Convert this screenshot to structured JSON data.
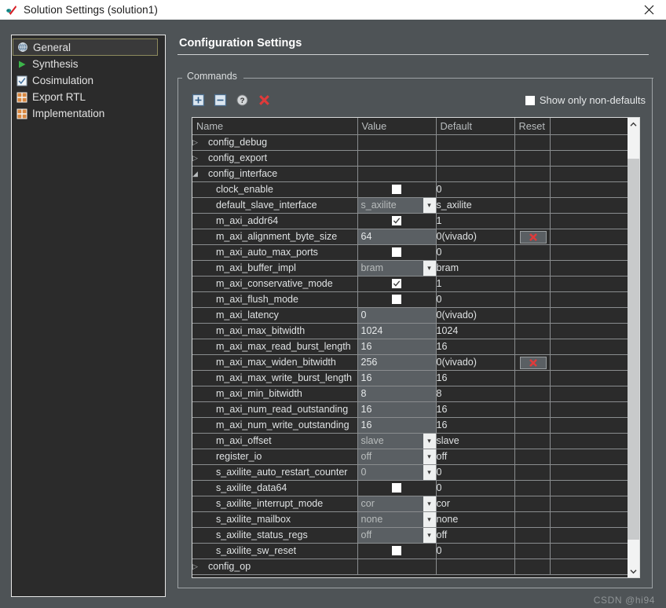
{
  "window": {
    "title": "Solution Settings (solution1)",
    "app_icon": "vivado-hls-icon",
    "close_label": "✕"
  },
  "sidebar": {
    "items": [
      {
        "label": "General",
        "icon": "gear-globe-icon",
        "selected": true
      },
      {
        "label": "Synthesis",
        "icon": "play-icon",
        "selected": false
      },
      {
        "label": "Cosimulation",
        "icon": "checkbox-icon",
        "selected": false
      },
      {
        "label": "Export RTL",
        "icon": "grid-icon",
        "selected": false
      },
      {
        "label": "Implementation",
        "icon": "grid-icon",
        "selected": false
      }
    ]
  },
  "main": {
    "title": "Configuration Settings",
    "group_label": "Commands",
    "toolbar": [
      {
        "name": "expand-all-icon",
        "tooltip": "Expand All"
      },
      {
        "name": "collapse-all-icon",
        "tooltip": "Collapse All"
      },
      {
        "name": "help-icon",
        "tooltip": "Help"
      },
      {
        "name": "delete-icon",
        "tooltip": "Delete"
      }
    ],
    "show_non_defaults": {
      "label": "Show only non-defaults",
      "checked": false
    }
  },
  "table": {
    "columns": [
      "Name",
      "Value",
      "Default",
      "Reset",
      ""
    ],
    "rows": [
      {
        "kind": "group",
        "expanded": false,
        "name": "config_debug",
        "value_type": "none",
        "value": "",
        "default": "",
        "reset": false
      },
      {
        "kind": "group",
        "expanded": false,
        "name": "config_export",
        "value_type": "none",
        "value": "",
        "default": "",
        "reset": false
      },
      {
        "kind": "group",
        "expanded": true,
        "name": "config_interface",
        "value_type": "none",
        "value": "",
        "default": "",
        "reset": false
      },
      {
        "kind": "child",
        "name": "clock_enable",
        "value_type": "checkbox",
        "value": false,
        "default": "0",
        "reset": false
      },
      {
        "kind": "child",
        "name": "default_slave_interface",
        "value_type": "combo",
        "value": "s_axilite",
        "default": "s_axilite",
        "reset": false
      },
      {
        "kind": "child",
        "name": "m_axi_addr64",
        "value_type": "checkbox",
        "value": true,
        "default": "1",
        "reset": false
      },
      {
        "kind": "child",
        "name": "m_axi_alignment_byte_size",
        "value_type": "text",
        "value": "64",
        "default": "0(vivado)",
        "reset": true
      },
      {
        "kind": "child",
        "name": "m_axi_auto_max_ports",
        "value_type": "checkbox",
        "value": false,
        "default": "0",
        "reset": false
      },
      {
        "kind": "child",
        "name": "m_axi_buffer_impl",
        "value_type": "combo",
        "value": "bram",
        "default": "bram",
        "reset": false
      },
      {
        "kind": "child",
        "name": "m_axi_conservative_mode",
        "value_type": "checkbox",
        "value": true,
        "default": "1",
        "reset": false
      },
      {
        "kind": "child",
        "name": "m_axi_flush_mode",
        "value_type": "checkbox",
        "value": false,
        "default": "0",
        "reset": false
      },
      {
        "kind": "child",
        "name": "m_axi_latency",
        "value_type": "text",
        "value": "0",
        "default": "0(vivado)",
        "reset": false
      },
      {
        "kind": "child",
        "name": "m_axi_max_bitwidth",
        "value_type": "text",
        "value": "1024",
        "default": "1024",
        "reset": false
      },
      {
        "kind": "child",
        "name": "m_axi_max_read_burst_length",
        "value_type": "text",
        "value": "16",
        "default": "16",
        "reset": false
      },
      {
        "kind": "child",
        "name": "m_axi_max_widen_bitwidth",
        "value_type": "text",
        "value": "256",
        "default": "0(vivado)",
        "reset": true
      },
      {
        "kind": "child",
        "name": "m_axi_max_write_burst_length",
        "value_type": "text",
        "value": "16",
        "default": "16",
        "reset": false
      },
      {
        "kind": "child",
        "name": "m_axi_min_bitwidth",
        "value_type": "text",
        "value": "8",
        "default": "8",
        "reset": false
      },
      {
        "kind": "child",
        "name": "m_axi_num_read_outstanding",
        "value_type": "text",
        "value": "16",
        "default": "16",
        "reset": false
      },
      {
        "kind": "child",
        "name": "m_axi_num_write_outstanding",
        "value_type": "text",
        "value": "16",
        "default": "16",
        "reset": false
      },
      {
        "kind": "child",
        "name": "m_axi_offset",
        "value_type": "combo",
        "value": "slave",
        "default": "slave",
        "reset": false
      },
      {
        "kind": "child",
        "name": "register_io",
        "value_type": "combo",
        "value": "off",
        "default": "off",
        "reset": false
      },
      {
        "kind": "child",
        "name": "s_axilite_auto_restart_counter",
        "value_type": "combo",
        "value": "0",
        "default": "0",
        "reset": false
      },
      {
        "kind": "child",
        "name": "s_axilite_data64",
        "value_type": "checkbox",
        "value": false,
        "default": "0",
        "reset": false
      },
      {
        "kind": "child",
        "name": "s_axilite_interrupt_mode",
        "value_type": "combo",
        "value": "cor",
        "default": "cor",
        "reset": false
      },
      {
        "kind": "child",
        "name": "s_axilite_mailbox",
        "value_type": "combo",
        "value": "none",
        "default": "none",
        "reset": false
      },
      {
        "kind": "child",
        "name": "s_axilite_status_regs",
        "value_type": "combo",
        "value": "off",
        "default": "off",
        "reset": false
      },
      {
        "kind": "child",
        "name": "s_axilite_sw_reset",
        "value_type": "checkbox",
        "value": false,
        "default": "0",
        "reset": false
      },
      {
        "kind": "group",
        "expanded": false,
        "name": "config_op",
        "value_type": "none",
        "value": "",
        "default": "",
        "reset": false
      }
    ]
  },
  "scrollbar": {
    "up_arrow": "▲",
    "down_arrow": "▼"
  },
  "watermark": "CSDN @hi94",
  "colors": {
    "window_bg": "#4e5356",
    "panel_bg": "#2b2b2b",
    "titlebar_bg": "#ffffff",
    "accent_selected": "#8d8a5e",
    "editable_cell": "#5a5f63",
    "reset_red": "#e03a3a"
  }
}
